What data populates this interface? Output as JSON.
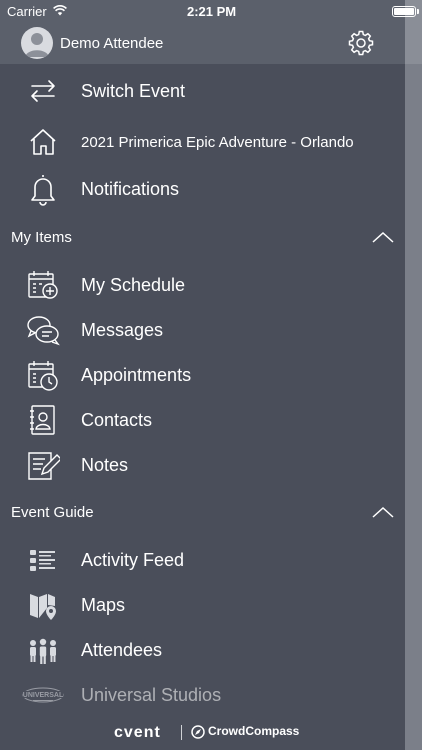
{
  "status_bar": {
    "carrier": "Carrier",
    "time": "2:21 PM"
  },
  "header": {
    "user_name": "Demo Attendee"
  },
  "menu": {
    "switch_event": "Switch Event",
    "event_name": "2021 Primerica Epic Adventure - Orlando",
    "notifications": "Notifications"
  },
  "my_items": {
    "title": "My Items",
    "items": [
      {
        "label": "My Schedule",
        "icon": "calendar-add-icon"
      },
      {
        "label": "Messages",
        "icon": "chat-bubbles-icon"
      },
      {
        "label": "Appointments",
        "icon": "calendar-clock-icon"
      },
      {
        "label": "Contacts",
        "icon": "contact-book-icon"
      },
      {
        "label": "Notes",
        "icon": "note-pencil-icon"
      }
    ]
  },
  "event_guide": {
    "title": "Event Guide",
    "items": [
      {
        "label": "Activity Feed",
        "icon": "list-icon"
      },
      {
        "label": "Maps",
        "icon": "map-pin-icon"
      },
      {
        "label": "Attendees",
        "icon": "people-icon"
      },
      {
        "label": "Universal Studios",
        "icon": "universal-logo"
      }
    ]
  },
  "footer": {
    "brand_left": "cvent",
    "brand_right": "CrowdCompass"
  },
  "colors": {
    "background": "#4a4e5a",
    "header": "#5b606b",
    "text": "#ffffff",
    "icon": "#d9dbe0"
  }
}
